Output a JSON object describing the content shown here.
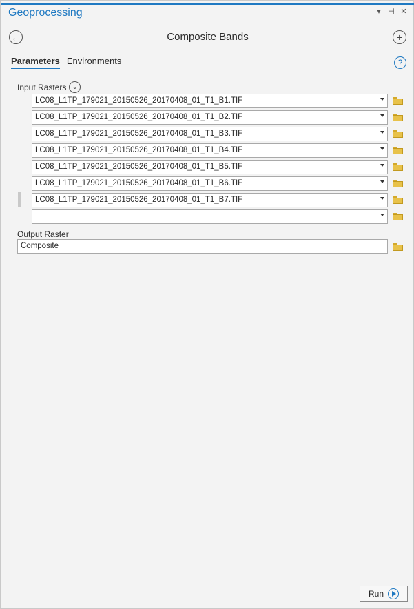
{
  "pane": {
    "title": "Geoprocessing",
    "controls": [
      "▾",
      "⊣",
      "✕"
    ]
  },
  "header": {
    "tool_title": "Composite Bands"
  },
  "tabs": [
    {
      "label": "Parameters",
      "active": true
    },
    {
      "label": "Environments",
      "active": false
    }
  ],
  "help_icon": "?",
  "input_rasters": {
    "label": "Input Rasters",
    "items": [
      "LC08_L1TP_179021_20150526_20170408_01_T1_B1.TIF",
      "LC08_L1TP_179021_20150526_20170408_01_T1_B2.TIF",
      "LC08_L1TP_179021_20150526_20170408_01_T1_B3.TIF",
      "LC08_L1TP_179021_20150526_20170408_01_T1_B4.TIF",
      "LC08_L1TP_179021_20150526_20170408_01_T1_B5.TIF",
      "LC08_L1TP_179021_20150526_20170408_01_T1_B6.TIF",
      "LC08_L1TP_179021_20150526_20170408_01_T1_B7.TIF",
      ""
    ]
  },
  "output_raster": {
    "label": "Output Raster",
    "value": "Composite"
  },
  "run_button": {
    "label": "Run"
  },
  "colors": {
    "accent": "#1f79c2",
    "folder": "#e8c24a"
  }
}
